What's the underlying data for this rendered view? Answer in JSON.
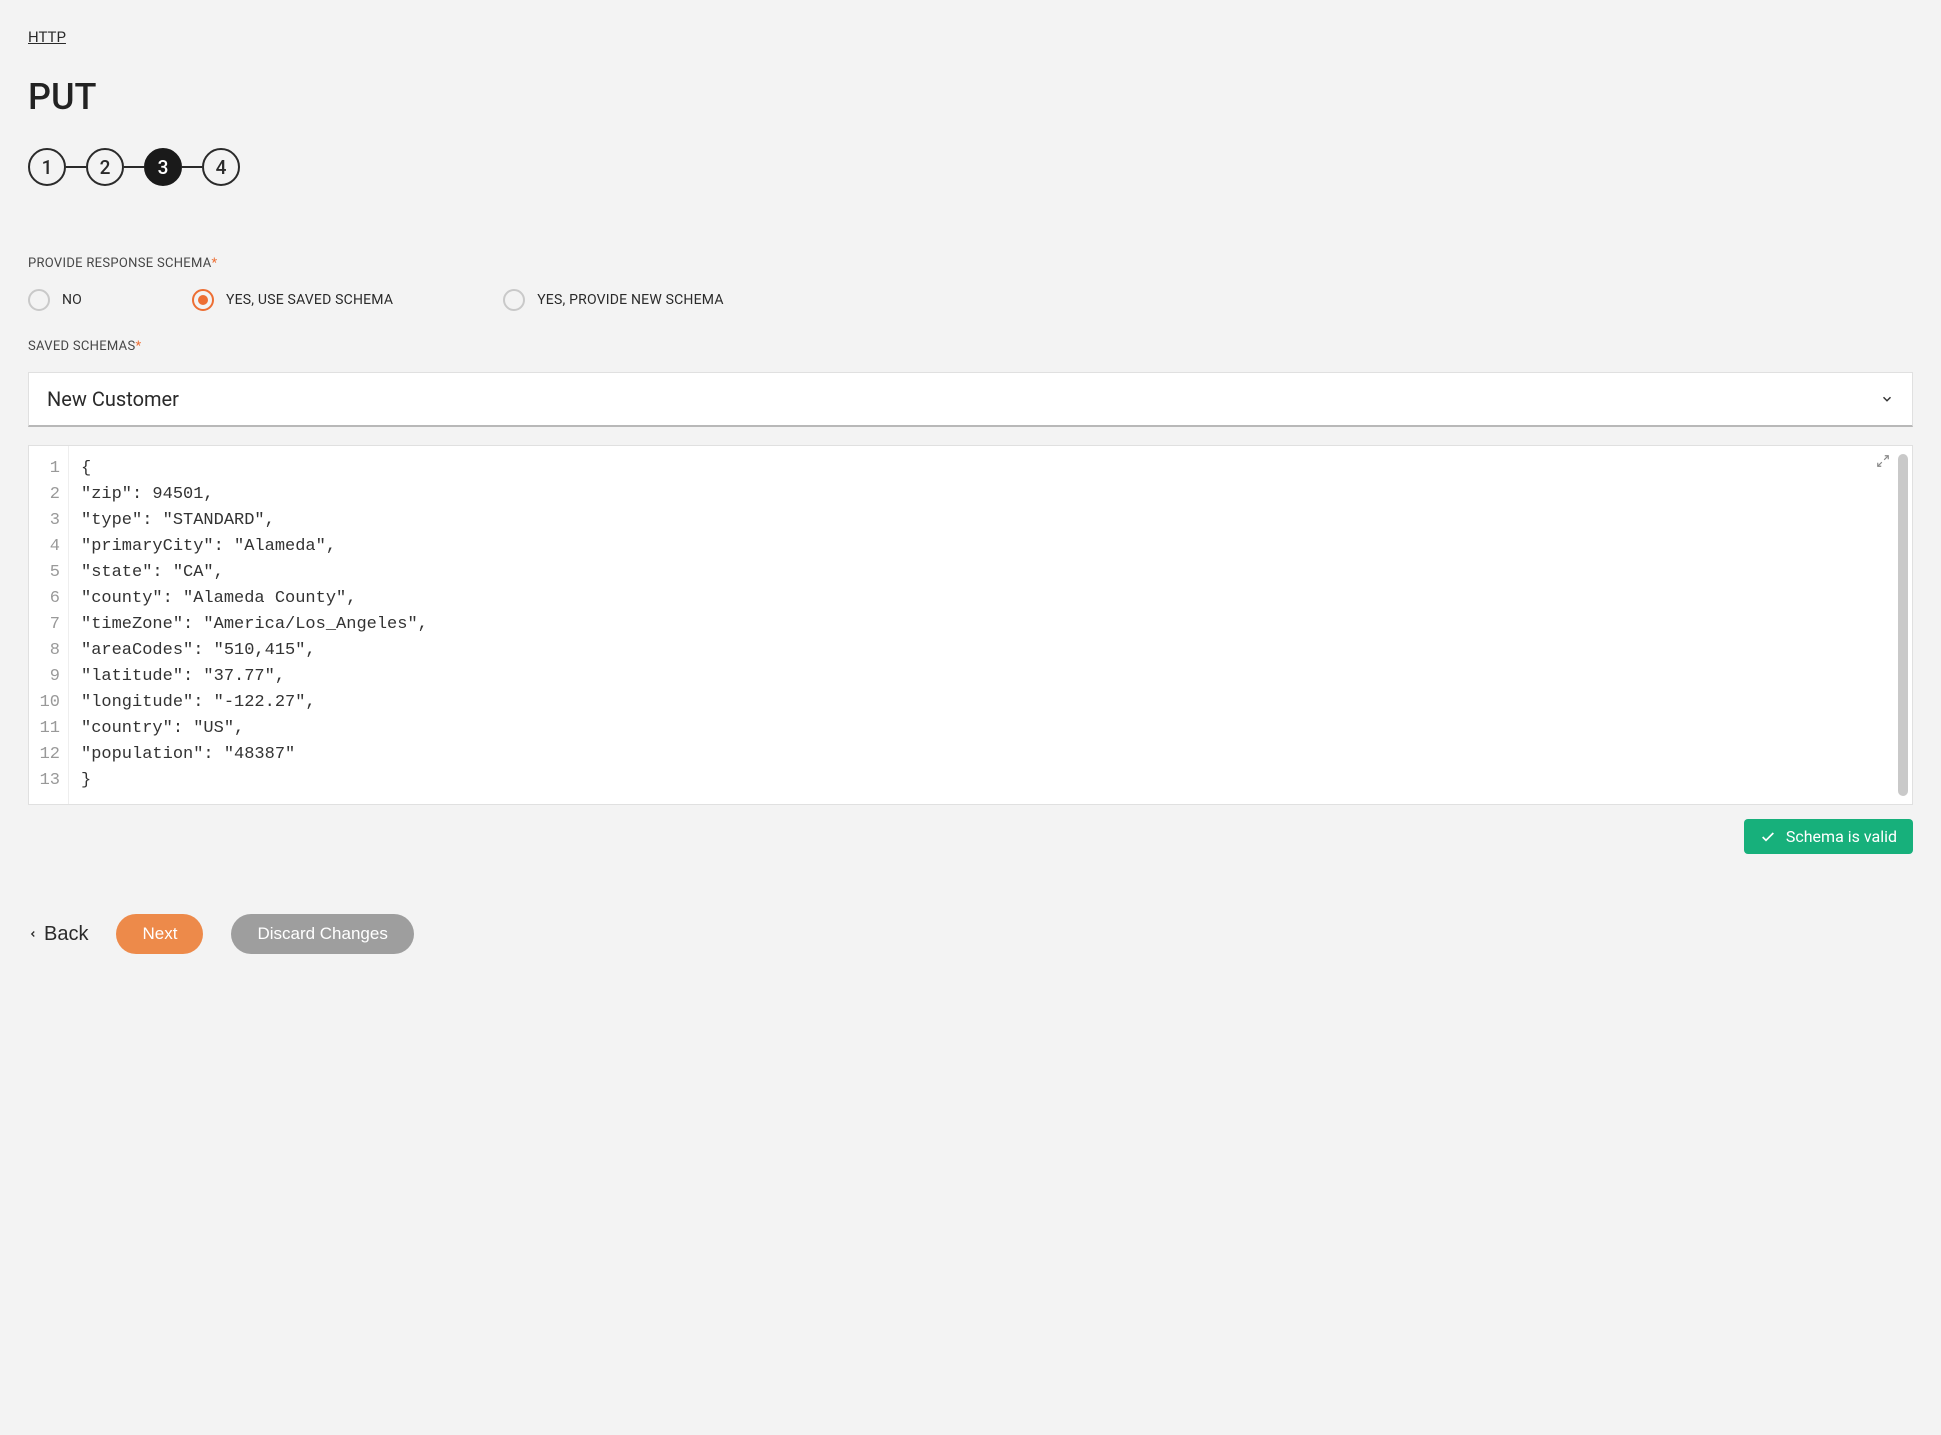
{
  "breadcrumb": "HTTP",
  "title": "PUT",
  "stepper": {
    "steps": [
      "1",
      "2",
      "3",
      "4"
    ],
    "active_index": 2
  },
  "response_schema": {
    "label": "PROVIDE RESPONSE SCHEMA",
    "options": [
      {
        "label": "NO",
        "selected": false
      },
      {
        "label": "YES, USE SAVED SCHEMA",
        "selected": true
      },
      {
        "label": "YES, PROVIDE NEW SCHEMA",
        "selected": false
      }
    ]
  },
  "saved_schemas": {
    "label": "SAVED SCHEMAS",
    "selected": "New Customer"
  },
  "code": {
    "lines": [
      "{",
      "\"zip\": 94501,",
      "\"type\": \"STANDARD\",",
      "\"primaryCity\": \"Alameda\",",
      "\"state\": \"CA\",",
      "\"county\": \"Alameda County\",",
      "\"timeZone\": \"America/Los_Angeles\",",
      "\"areaCodes\": \"510,415\",",
      "\"latitude\": \"37.77\",",
      "\"longitude\": \"-122.27\",",
      "\"country\": \"US\",",
      "\"population\": \"48387\"",
      "}"
    ]
  },
  "validation": {
    "message": "Schema is valid"
  },
  "buttons": {
    "back": "Back",
    "next": "Next",
    "discard": "Discard Changes"
  },
  "required_marker": "*"
}
